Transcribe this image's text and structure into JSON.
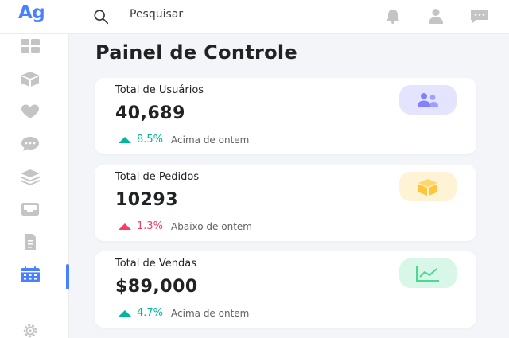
{
  "header": {
    "logo": "Ag",
    "search_placeholder": "Pesquisar",
    "icons": [
      "search-icon",
      "bell-icon",
      "user-icon",
      "chat-icon"
    ]
  },
  "sidebar": {
    "items": [
      {
        "icon": "grid-icon"
      },
      {
        "icon": "cube-icon"
      },
      {
        "icon": "heart-icon"
      },
      {
        "icon": "chat-bubble-icon"
      },
      {
        "icon": "layers-icon"
      },
      {
        "icon": "inbox-icon"
      },
      {
        "icon": "document-icon"
      },
      {
        "icon": "calendar-icon",
        "active": true
      },
      {
        "icon": "settings-icon"
      }
    ]
  },
  "main": {
    "title": "Painel de Controle",
    "cards": [
      {
        "label": "Total de Usuários",
        "value": "40,689",
        "trend": "up",
        "percent": "8.5%",
        "trend_text": "Acima de ontem",
        "icon": "users-icon",
        "icon_bg": "#e5e4ff",
        "icon_color": "#8280ff",
        "trend_color": "#00b69b"
      },
      {
        "label": "Total de Pedidos",
        "value": "10293",
        "trend": "down",
        "percent": "1.3%",
        "trend_text": "Abaixo de ontem",
        "icon": "box-icon",
        "icon_bg": "#fff3d6",
        "icon_color": "#fec53d",
        "trend_color": "#f93c65"
      },
      {
        "label": "Total de Vendas",
        "value": "$89,000",
        "trend": "up",
        "percent": "4.7%",
        "trend_text": "Acima de ontem",
        "icon": "line-chart-icon",
        "icon_bg": "#d9f7e8",
        "icon_color": "#4ad991",
        "trend_color": "#00b69b"
      }
    ]
  },
  "colors": {
    "accent": "#4880ff",
    "background": "#f4f5f9",
    "icon_gray": "#c4c4c4"
  }
}
